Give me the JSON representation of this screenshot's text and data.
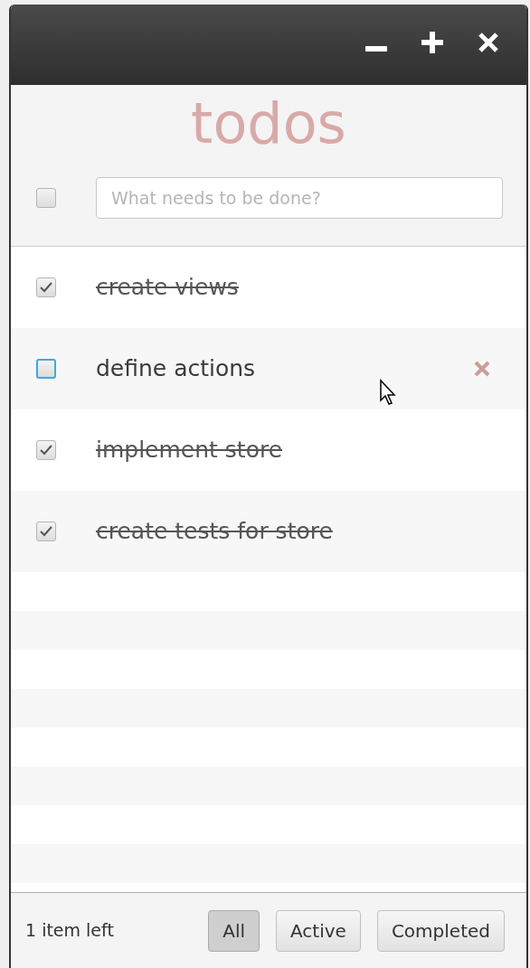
{
  "header": {
    "title": "todos",
    "toggle_all": {
      "checked": false
    },
    "new_todo": {
      "placeholder": "What needs to be done?"
    }
  },
  "todos": [
    {
      "text": "create views",
      "completed": true,
      "hovered": false
    },
    {
      "text": "define actions",
      "completed": false,
      "hovered": true
    },
    {
      "text": "implement store",
      "completed": true,
      "hovered": false
    },
    {
      "text": "create tests for store",
      "completed": true,
      "hovered": false
    }
  ],
  "footer": {
    "count": "1 item left",
    "filters": [
      {
        "label": "All",
        "selected": true
      },
      {
        "label": "Active",
        "selected": false
      },
      {
        "label": "Completed",
        "selected": false
      }
    ]
  }
}
